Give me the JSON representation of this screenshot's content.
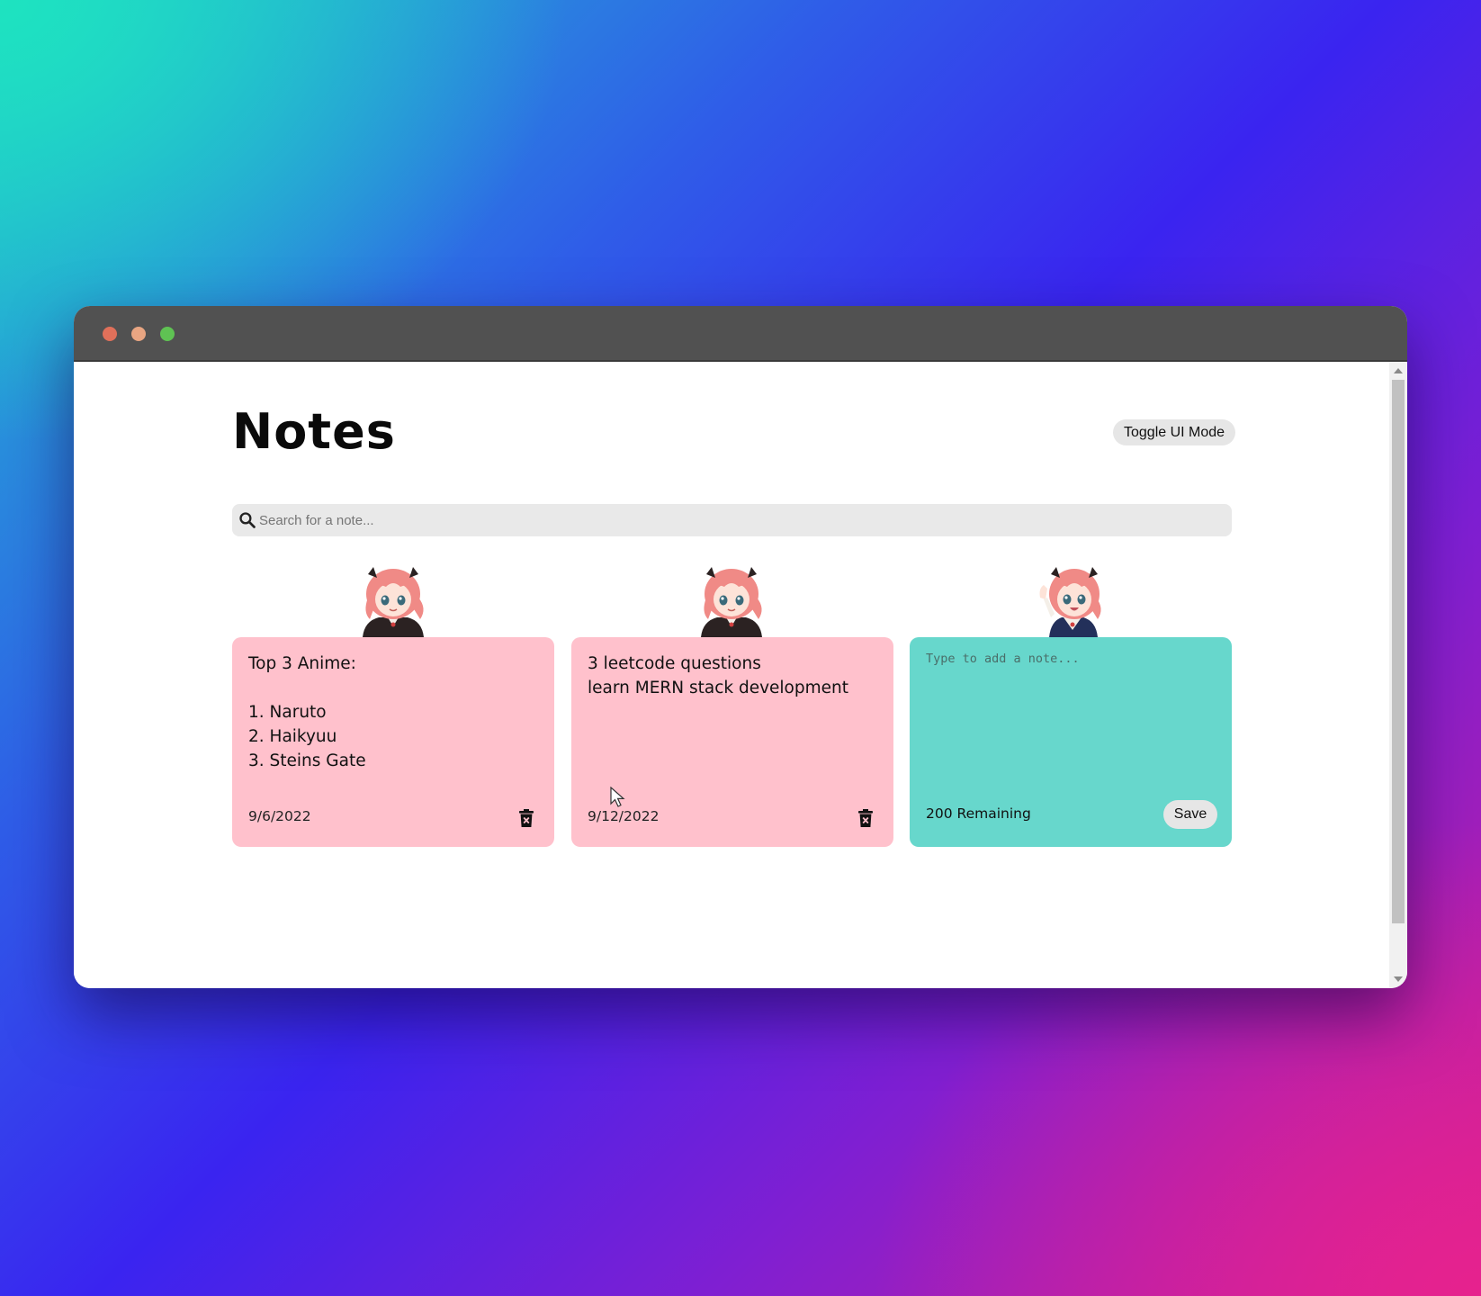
{
  "window": {
    "traffic_lights": [
      {
        "name": "close",
        "color": "#e0705a"
      },
      {
        "name": "minimize",
        "color": "#e8a582"
      },
      {
        "name": "maximize",
        "color": "#5fc253"
      }
    ],
    "titlebar_color": "#515151"
  },
  "header": {
    "title": "Notes",
    "toggle_label": "Toggle UI Mode"
  },
  "search": {
    "placeholder": "Search for a note...",
    "value": "",
    "icon": "search-icon"
  },
  "notes": [
    {
      "text": "Top 3 Anime:\n\n1. Naruto\n2. Haikyuu\n3. Steins Gate",
      "date": "9/6/2022",
      "color": "#ffc1cc",
      "icon": "delete-icon"
    },
    {
      "text": "3 leetcode questions\nlearn MERN stack development",
      "date": "9/12/2022",
      "color": "#ffc1cc",
      "icon": "delete-icon"
    }
  ],
  "new_note": {
    "placeholder": "Type to add a note...",
    "value": "",
    "remaining": "200 Remaining",
    "save_label": "Save",
    "color": "#67d7cc"
  },
  "colors": {
    "note_pink": "#ffc1cc",
    "note_teal": "#67d7cc",
    "button_bg": "#e6e6e6",
    "search_bg": "#e9e9e9"
  }
}
